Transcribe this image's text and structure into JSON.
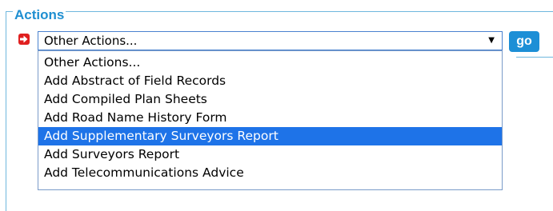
{
  "panel": {
    "legend": "Actions"
  },
  "actions_select": {
    "value": "Other Actions...",
    "caret": "▼"
  },
  "go_button": {
    "label": "go"
  },
  "dropdown": {
    "options": [
      "Other Actions...",
      "Add Abstract of Field Records",
      "Add Compiled Plan Sheets",
      "Add Road Name History Form",
      "Add Supplementary Surveyors Report",
      "Add Surveyors Report",
      "Add Telecommunications Advice"
    ],
    "highlighted": "Add Supplementary Surveyors Report"
  },
  "colors": {
    "accent": "#1d8fd6",
    "highlight": "#1e73e8",
    "icon": "#e02020"
  }
}
